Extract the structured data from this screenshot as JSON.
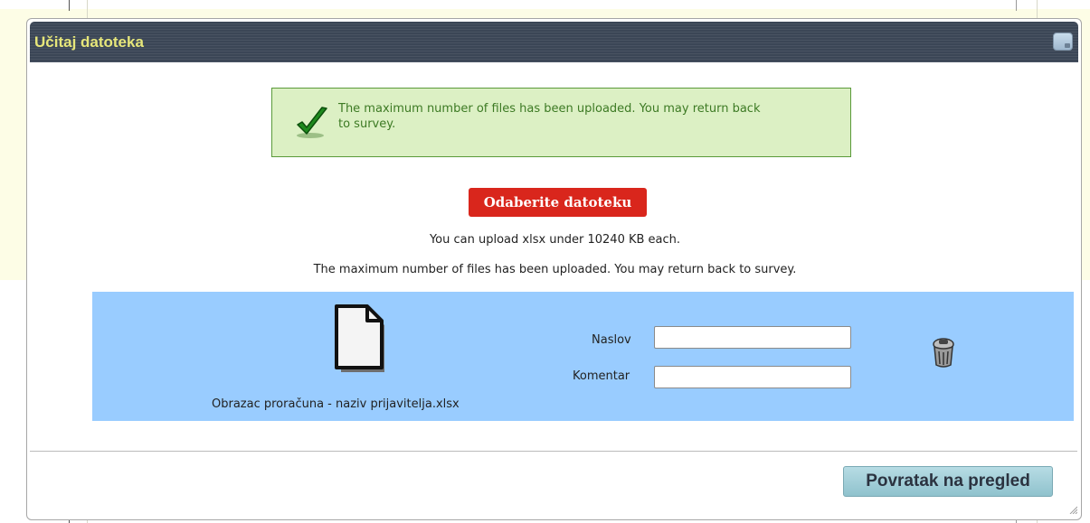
{
  "dialog": {
    "title": "Učitaj datoteka",
    "close_icon": "close-icon"
  },
  "success": {
    "message": "The maximum number of files has been uploaded. You may return back to survey.",
    "icon": "checkmark-icon",
    "color": "#3d7a24"
  },
  "upload": {
    "choose_button": "Odaberite datoteku",
    "choose_button_color": "#d9261c",
    "info_allowed": "You can upload xlsx under 10240 KB each.",
    "info_max": "The maximum number of files has been uploaded. You may return back to survey."
  },
  "file": {
    "icon": "file-icon",
    "name": "Obrazac proračuna - naziv prijavitelja.xlsx",
    "title_label": "Naslov",
    "title_value": "",
    "comment_label": "Komentar",
    "comment_value": "",
    "delete_icon": "trash-icon",
    "row_color": "#99ccff"
  },
  "footer": {
    "back_button": "Povratak na pregled"
  }
}
